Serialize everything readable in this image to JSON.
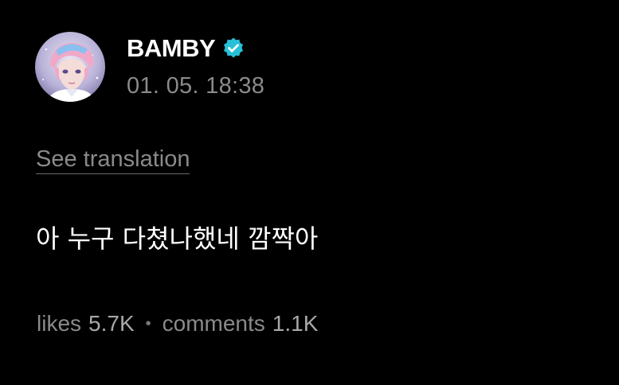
{
  "post": {
    "author": {
      "name": "BAMBY",
      "verified_icon": "verified-badge-icon",
      "avatar_icon": "avatar-image"
    },
    "timestamp": "01. 05. 18:38",
    "translate_link": "See translation",
    "content": "아 누구 다쳤나했네 깜짝아",
    "stats": {
      "likes_label": "likes",
      "likes_value": "5.7K",
      "separator": "•",
      "comments_label": "comments",
      "comments_value": "1.1K"
    }
  },
  "colors": {
    "background": "#000000",
    "primary_text": "#ffffff",
    "secondary_text": "#8a8a8a",
    "verified_badge": "#28c0d8"
  }
}
